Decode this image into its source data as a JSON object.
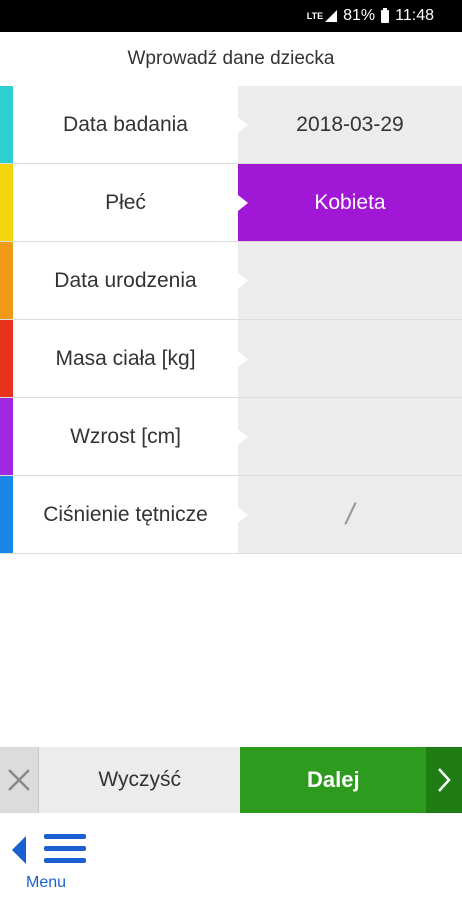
{
  "status_bar": {
    "network": "LTE",
    "battery": "81%",
    "time": "11:48"
  },
  "header": {
    "title": "Wprowadź dane dziecka"
  },
  "form": {
    "rows": [
      {
        "label": "Data badania",
        "value": "2018-03-29",
        "color": "#2ecfcf"
      },
      {
        "label": "Płeć",
        "value": "Kobieta",
        "color": "#f2d50e",
        "selected": true
      },
      {
        "label": "Data urodzenia",
        "value": "",
        "color": "#f09a1a"
      },
      {
        "label": "Masa ciała [kg]",
        "value": "",
        "color": "#e8321e"
      },
      {
        "label": "Wzrost [cm]",
        "value": "",
        "color": "#a028e0"
      },
      {
        "label": "Ciśnienie tętnicze",
        "value": "/",
        "color": "#1a86e6"
      }
    ]
  },
  "actions": {
    "clear_label": "Wyczyść",
    "next_label": "Dalej"
  },
  "menu": {
    "label": "Menu"
  },
  "icons": {
    "clear": "close-icon",
    "next": "chevron-right-icon",
    "menu": "hamburger-icon",
    "back": "back-triangle-icon"
  }
}
